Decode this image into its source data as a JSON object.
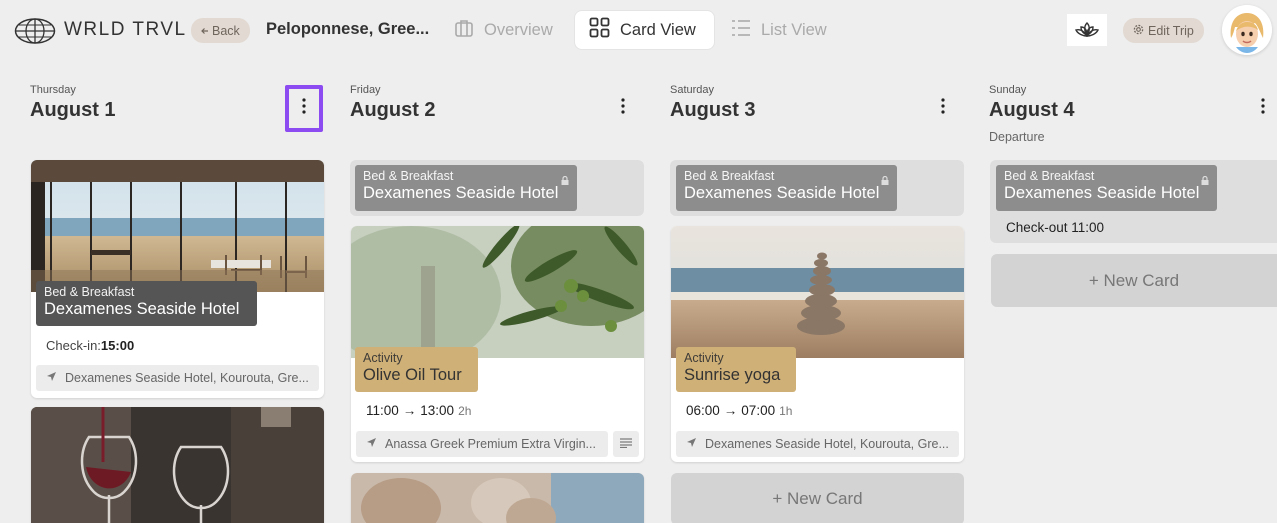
{
  "header": {
    "logo_text": "WRLD TRVL",
    "back_label": "Back",
    "trip_title": "Peloponnese, Gree...",
    "nav": {
      "overview": "Overview",
      "card_view": "Card View",
      "list_view": "List View"
    },
    "edit_trip": "Edit Trip"
  },
  "days": [
    {
      "weekday": "Thursday",
      "date": "August 1",
      "cards": {
        "hotel": {
          "type": "Bed & Breakfast",
          "name": "Dexamenes Seaside Hotel",
          "checkin_label": "Check-in:",
          "checkin_time": "15:00",
          "location": "Dexamenes Seaside Hotel, Kourouta, Gre..."
        }
      }
    },
    {
      "weekday": "Friday",
      "date": "August 2",
      "hotel": {
        "type": "Bed & Breakfast",
        "name": "Dexamenes Seaside Hotel"
      },
      "activity": {
        "type": "Activity",
        "name": "Olive Oil Tour",
        "start": "11:00",
        "arrow": "→",
        "end": "13:00",
        "duration": "2h",
        "location": "Anassa Greek Premium Extra Virgin..."
      }
    },
    {
      "weekday": "Saturday",
      "date": "August 3",
      "hotel": {
        "type": "Bed & Breakfast",
        "name": "Dexamenes Seaside Hotel"
      },
      "activity": {
        "type": "Activity",
        "name": "Sunrise yoga",
        "start": "06:00",
        "arrow": "→",
        "end": "07:00",
        "duration": "1h",
        "location": "Dexamenes Seaside Hotel, Kourouta, Gre..."
      },
      "new_card": "+ New Card"
    },
    {
      "weekday": "Sunday",
      "date": "August 4",
      "subtitle": "Departure",
      "hotel": {
        "type": "Bed & Breakfast",
        "name": "Dexamenes Seaside Hotel",
        "checkout": "Check-out 11:00"
      },
      "new_card": "+ New Card"
    }
  ],
  "colors": {
    "accent_highlight": "#8c4bf0",
    "activity_tag": "#cfb077",
    "hotel_tag": "#8d8d8d",
    "back_btn_bg": "#e1d9d2"
  }
}
